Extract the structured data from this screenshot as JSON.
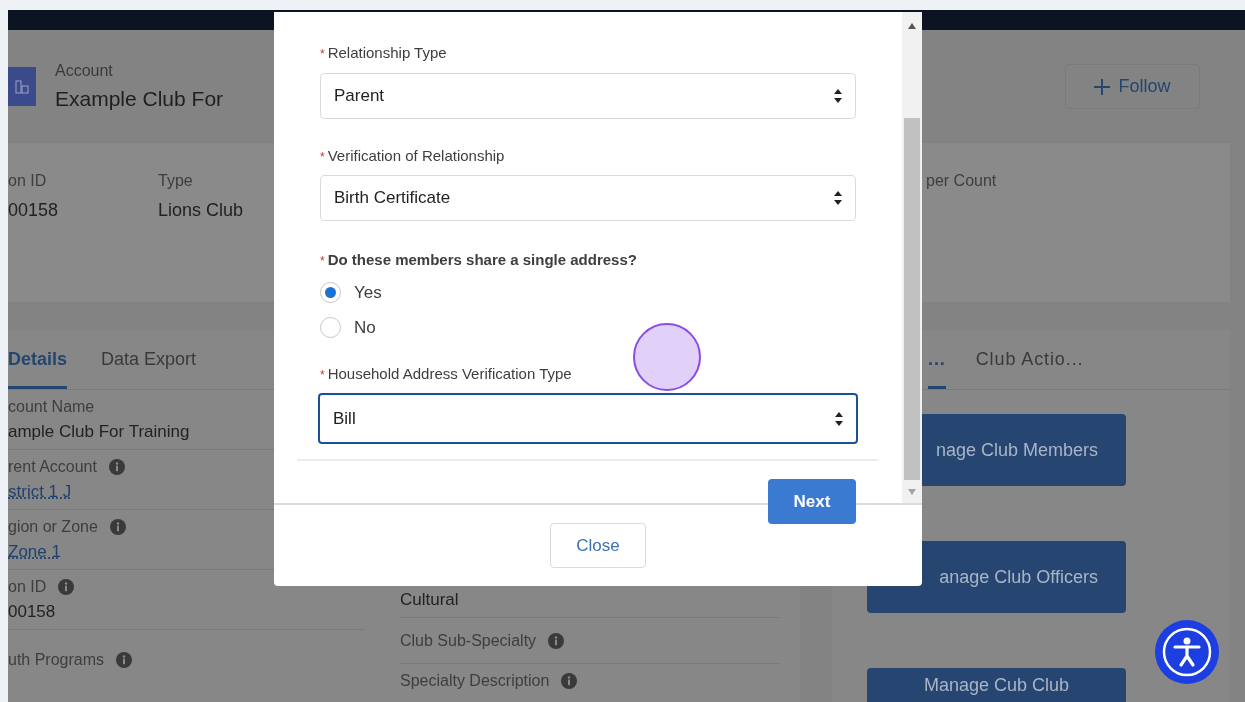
{
  "header": {
    "object_type": "Account",
    "title": "Example Club For",
    "follow_button": "Follow"
  },
  "highlights": [
    {
      "label": "on ID",
      "value": "00158"
    },
    {
      "label": "Type",
      "value": "Lions Club"
    },
    {
      "label": "per Count"
    }
  ],
  "tabs": [
    {
      "label": "Details",
      "selected": true
    },
    {
      "label": "Data Export",
      "selected": false
    }
  ],
  "fields_left": [
    {
      "label": "count Name",
      "value": "ample Club For Training",
      "info": false,
      "link": false
    },
    {
      "label": "rent Account",
      "value": "strict 1 J",
      "info": true,
      "link": true
    },
    {
      "label": "gion or Zone",
      "value": "Zone 1",
      "info": true,
      "link": true
    },
    {
      "label": "on ID",
      "value": "00158",
      "info": true,
      "link": false
    },
    {
      "label": "uth Programs",
      "info": true
    }
  ],
  "fields_right": [
    {
      "value": "Cultural",
      "link": false
    },
    {
      "label": "Club Sub-Specialty",
      "info": true
    },
    {
      "label": "Specialty Description",
      "info": true
    }
  ],
  "side_tabs": [
    {
      "label": "...",
      "selected": true
    },
    {
      "label": "Club Actio...",
      "selected": false
    }
  ],
  "side_buttons": [
    "nage Club Members",
    "anage Club Officers",
    "Manage Cub Club"
  ],
  "modal": {
    "fields": [
      {
        "kind": "select",
        "label": "Relationship Type",
        "required_mark": "*",
        "value": "Parent",
        "focused": false
      },
      {
        "kind": "select",
        "label": "Verification of Relationship",
        "required_mark": "*",
        "value": "Birth Certificate",
        "focused": false
      },
      {
        "kind": "radio",
        "label": "Do these members share a single address?",
        "required_mark": "*",
        "options": [
          {
            "label": "Yes",
            "selected": true
          },
          {
            "label": "No",
            "selected": false
          }
        ]
      },
      {
        "kind": "select",
        "label": "Household Address Verification Type",
        "required_mark": "*",
        "value": "Bill",
        "focused": true
      }
    ],
    "next_button": "Next",
    "close_button": "Close"
  }
}
